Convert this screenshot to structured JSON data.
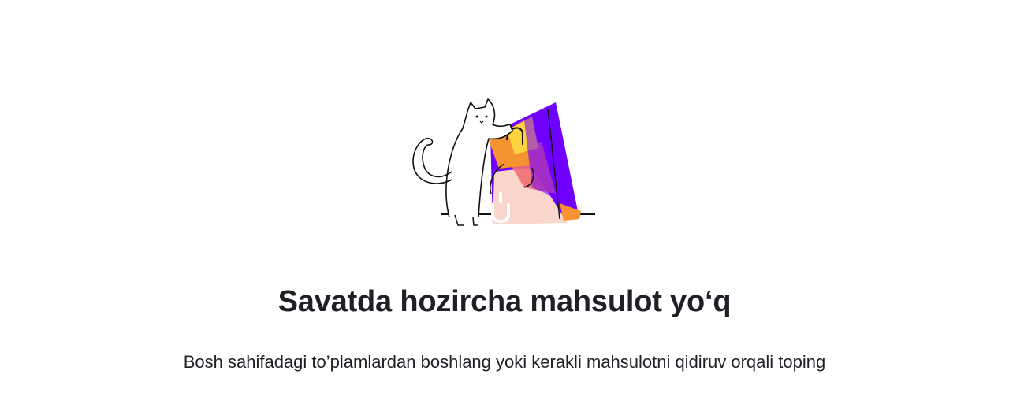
{
  "empty_cart": {
    "illustration_icon": "cat-with-shopping-bag-icon",
    "title": "Savatda hozircha mahsulot yo‘q",
    "subtitle": "Bosh sahifadagi to’plamlardan boshlang yoki kerakli mahsulotni qidiruv orqali toping"
  },
  "colors": {
    "brand_purple": "#7000ff",
    "bag_pink": "#f9d6cc",
    "bag_orange": "#f59331",
    "bag_yellow": "#ffd33d",
    "bag_red": "#ef6e72",
    "text": "#1f2026"
  }
}
